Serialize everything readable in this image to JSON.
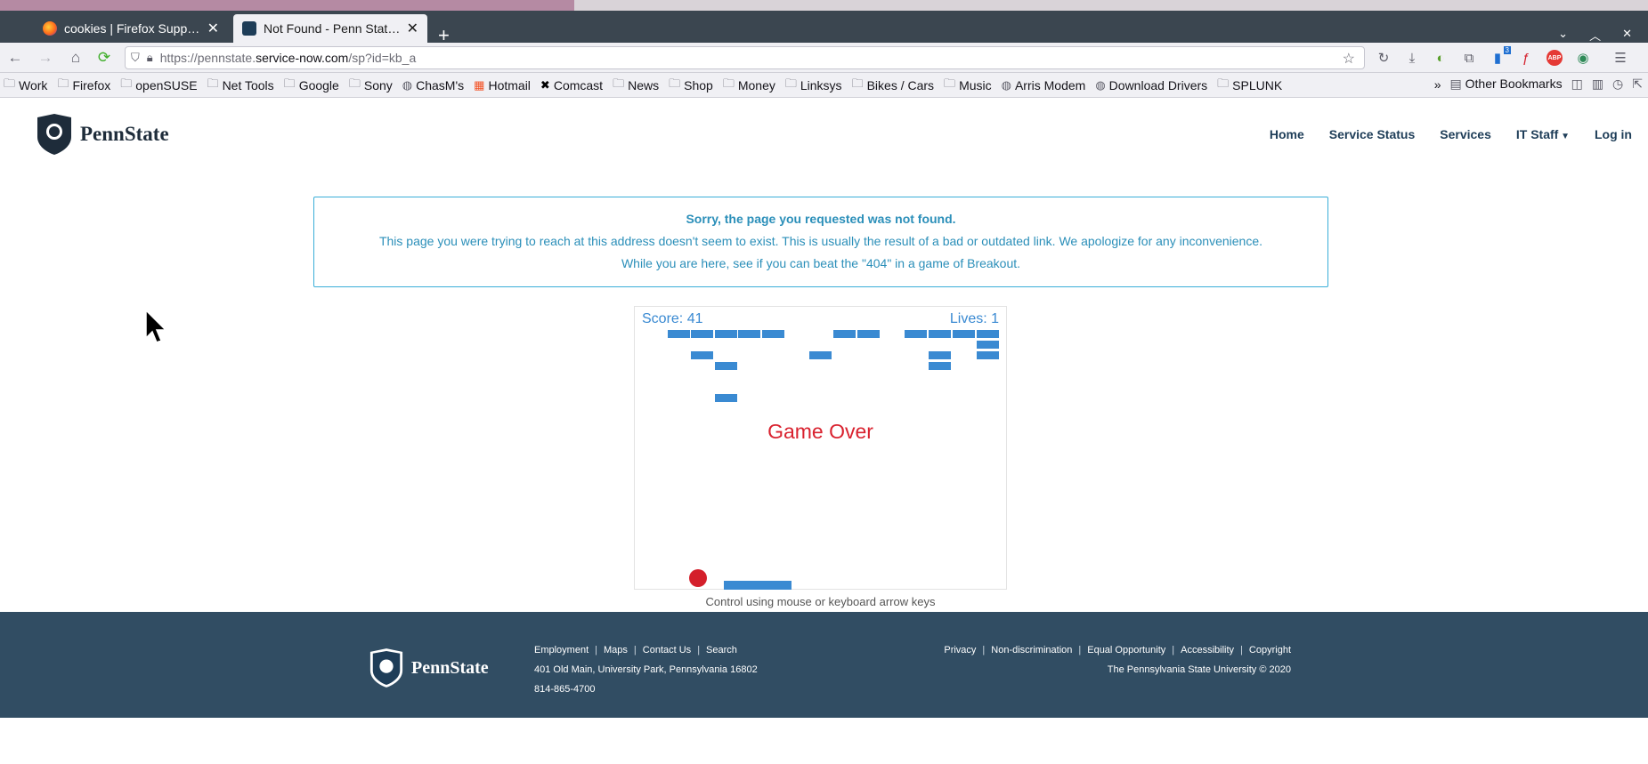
{
  "browser": {
    "tabs": [
      {
        "title": "cookies | Firefox Support F",
        "active": false
      },
      {
        "title": "Not Found - Penn State's IT",
        "active": true
      }
    ],
    "url": {
      "prefix": "https://pennstate.",
      "domain": "service-now.com",
      "path": "/sp?id=kb_a"
    },
    "extension_badge": "3",
    "abp_label": "ABP",
    "bookmarks": [
      {
        "label": "Work",
        "icon": "folder-icon"
      },
      {
        "label": "Firefox",
        "icon": "folder-icon"
      },
      {
        "label": "openSUSE",
        "icon": "folder-icon"
      },
      {
        "label": "Net Tools",
        "icon": "folder-icon"
      },
      {
        "label": "Google",
        "icon": "folder-icon"
      },
      {
        "label": "Sony",
        "icon": "folder-icon"
      },
      {
        "label": "ChasM's",
        "icon": "globe-icon"
      },
      {
        "label": "Hotmail",
        "icon": "windows-icon"
      },
      {
        "label": "Comcast",
        "icon": "x-icon"
      },
      {
        "label": "News",
        "icon": "folder-icon"
      },
      {
        "label": "Shop",
        "icon": "folder-icon"
      },
      {
        "label": "Money",
        "icon": "folder-icon"
      },
      {
        "label": "Linksys",
        "icon": "folder-icon"
      },
      {
        "label": "Bikes / Cars",
        "icon": "folder-icon"
      },
      {
        "label": "Music",
        "icon": "folder-icon"
      },
      {
        "label": "Arris Modem",
        "icon": "globe-icon"
      },
      {
        "label": "Download Drivers",
        "icon": "globe-icon"
      },
      {
        "label": "SPLUNK",
        "icon": "folder-icon"
      }
    ],
    "other_bookmarks": "Other Bookmarks"
  },
  "site": {
    "logo_text": "PennState",
    "nav": [
      "Home",
      "Service Status",
      "Services",
      "IT Staff",
      "Log in"
    ]
  },
  "alert": {
    "heading": "Sorry, the page you requested was not found.",
    "body": "This page you were trying to reach at this address doesn't seem to exist. This is usually the result of a bad or outdated link. We apologize for any inconvenience.",
    "game_invite": "While you are here, see if you can beat the \"404\" in a game of Breakout."
  },
  "game": {
    "score_text": "Score: 41",
    "lives_text": "Lives: 1",
    "status": "Game Over",
    "hint": "Control using mouse or keyboard arrow keys",
    "brick_color": "#3a8ad2",
    "ball_color": "#d41f2b"
  },
  "footer": {
    "logo_text": "PennState",
    "links_left": [
      "Employment",
      "Maps",
      "Contact Us",
      "Search"
    ],
    "address": "401 Old Main, University Park, Pennsylvania 16802",
    "phone": "814-865-4700",
    "links_right": [
      "Privacy",
      "Non-discrimination",
      "Equal Opportunity",
      "Accessibility",
      "Copyright"
    ],
    "copyright": "The Pennsylvania State University © 2020",
    "bg_color": "#314d63"
  }
}
